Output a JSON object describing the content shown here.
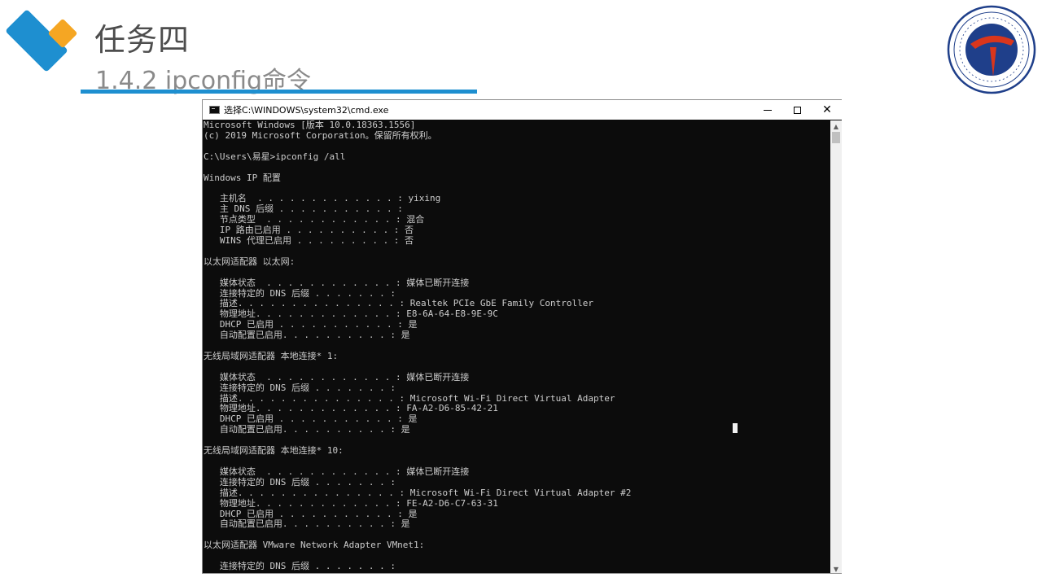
{
  "slide": {
    "title": "任务四",
    "subtitle": "1.4.2 ipconfig命令",
    "colors": {
      "accent_blue": "#1e8fd0",
      "accent_orange": "#f5a623",
      "seal_blue": "#1f3f8a",
      "seal_red": "#d9361c"
    }
  },
  "window": {
    "title": "选择C:\\WINDOWS\\system32\\cmd.exe",
    "minimize": "–",
    "close": "✕"
  },
  "console": {
    "lines": [
      "Microsoft Windows [版本 10.0.18363.1556]",
      "(c) 2019 Microsoft Corporation。保留所有权利。",
      "",
      "C:\\Users\\易星>ipconfig /all",
      "",
      "Windows IP 配置",
      "",
      "   主机名  . . . . . . . . . . . . . : yixing",
      "   主 DNS 后缀 . . . . . . . . . . . :",
      "   节点类型  . . . . . . . . . . . . : 混合",
      "   IP 路由已启用 . . . . . . . . . . : 否",
      "   WINS 代理已启用 . . . . . . . . . : 否",
      "",
      "以太网适配器 以太网:",
      "",
      "   媒体状态  . . . . . . . . . . . . : 媒体已断开连接",
      "   连接特定的 DNS 后缀 . . . . . . . :",
      "   描述. . . . . . . . . . . . . . . : Realtek PCIe GbE Family Controller",
      "   物理地址. . . . . . . . . . . . . : E8-6A-64-E8-9E-9C",
      "   DHCP 已启用 . . . . . . . . . . . : 是",
      "   自动配置已启用. . . . . . . . . . : 是",
      "",
      "无线局域网适配器 本地连接* 1:",
      "",
      "   媒体状态  . . . . . . . . . . . . : 媒体已断开连接",
      "   连接特定的 DNS 后缀 . . . . . . . :",
      "   描述. . . . . . . . . . . . . . . : Microsoft Wi-Fi Direct Virtual Adapter",
      "   物理地址. . . . . . . . . . . . . : FA-A2-D6-85-42-21",
      "   DHCP 已启用 . . . . . . . . . . . : 是",
      "   自动配置已启用. . . . . . . . . . : 是",
      "",
      "无线局域网适配器 本地连接* 10:",
      "",
      "   媒体状态  . . . . . . . . . . . . : 媒体已断开连接",
      "   连接特定的 DNS 后缀 . . . . . . . :",
      "   描述. . . . . . . . . . . . . . . : Microsoft Wi-Fi Direct Virtual Adapter #2",
      "   物理地址. . . . . . . . . . . . . : FE-A2-D6-C7-63-31",
      "   DHCP 已启用 . . . . . . . . . . . : 是",
      "   自动配置已启用. . . . . . . . . . : 是",
      "",
      "以太网适配器 VMware Network Adapter VMnet1:",
      "",
      "   连接特定的 DNS 后缀 . . . . . . . :"
    ]
  }
}
